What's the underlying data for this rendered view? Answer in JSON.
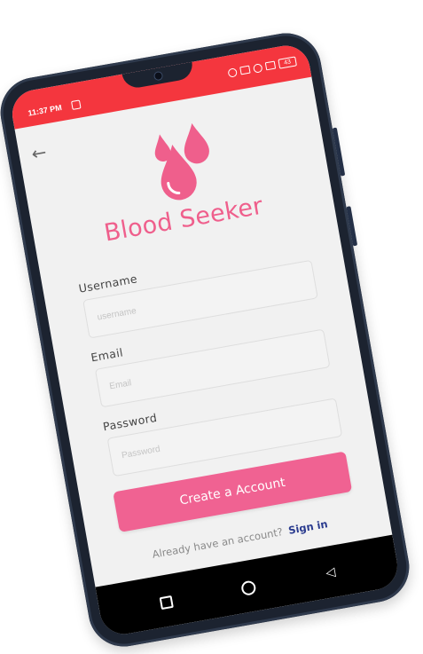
{
  "status_bar": {
    "time": "11:37 PM",
    "battery": "43",
    "bar_color": "#f4363e"
  },
  "header": {
    "back_icon": "arrow-left-icon"
  },
  "logo": {
    "icon": "blood-drops-icon",
    "color": "#ef5f8c"
  },
  "app_title": "Blood Seeker",
  "form": {
    "username": {
      "label": "Username",
      "placeholder": "username",
      "value": ""
    },
    "email": {
      "label": "Email",
      "placeholder": "Email",
      "value": ""
    },
    "password": {
      "label": "Password",
      "placeholder": "Password",
      "value": ""
    }
  },
  "create_button": {
    "label": "Create a Account",
    "color": "#f06292"
  },
  "signin": {
    "prompt": "Already have an account?",
    "link": "Sign in",
    "link_color": "#2b3c8f"
  },
  "nav_bar": {
    "buttons": [
      "recent-apps-icon",
      "home-icon",
      "back-triangle-icon"
    ]
  }
}
